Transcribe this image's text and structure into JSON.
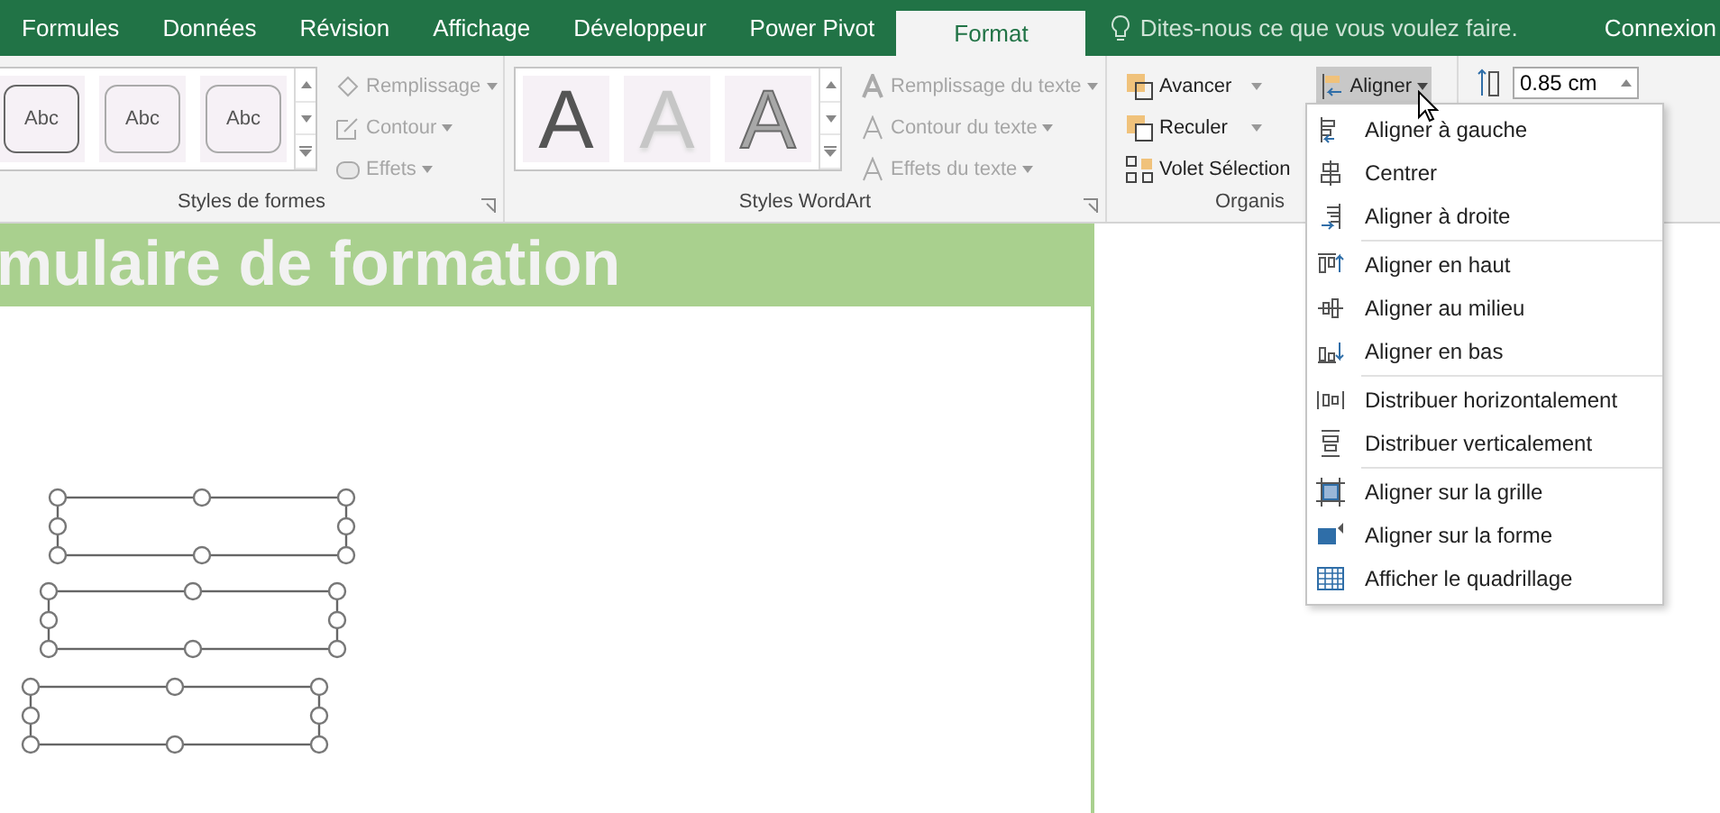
{
  "tabs": [
    {
      "label": "Formules",
      "selected": false
    },
    {
      "label": "Données",
      "selected": false
    },
    {
      "label": "Révision",
      "selected": false
    },
    {
      "label": "Affichage",
      "selected": false
    },
    {
      "label": "Développeur",
      "selected": false
    },
    {
      "label": "Power Pivot",
      "selected": false
    },
    {
      "label": "Format",
      "selected": true
    }
  ],
  "tell_me": {
    "placeholder": "Dites-nous ce que vous voulez faire."
  },
  "account": "Connexion",
  "shape_styles": {
    "label": "Styles de formes",
    "gallery": [
      "Abc",
      "Abc",
      "Abc"
    ],
    "buttons": [
      {
        "label": "Remplissage",
        "disabled": true
      },
      {
        "label": "Contour",
        "disabled": true
      },
      {
        "label": "Effets",
        "disabled": true
      }
    ]
  },
  "wordart_styles": {
    "label": "Styles WordArt",
    "gallery": [
      "A",
      "A",
      "A"
    ],
    "buttons": [
      {
        "label": "Remplissage du texte",
        "disabled": true
      },
      {
        "label": "Contour du texte",
        "disabled": true
      },
      {
        "label": "Effets du texte",
        "disabled": true
      }
    ]
  },
  "arrange": {
    "label": "Organis",
    "buttons": [
      {
        "label": "Avancer"
      },
      {
        "label": "Reculer"
      },
      {
        "label": "Volet Sélection"
      }
    ],
    "align_button": {
      "label": "Aligner",
      "pressed": true
    }
  },
  "size": {
    "height": "0.85 cm"
  },
  "sheet": {
    "title": "mulaire de formation"
  },
  "align_menu": [
    {
      "label": "Aligner à gauche",
      "separator_before": false
    },
    {
      "label": "Centrer",
      "separator_before": false
    },
    {
      "label": "Aligner à droite",
      "separator_before": false
    },
    {
      "label": "Aligner en haut",
      "separator_before": true
    },
    {
      "label": "Aligner au milieu",
      "separator_before": false
    },
    {
      "label": "Aligner en bas",
      "separator_before": false
    },
    {
      "label": "Distribuer horizontalement",
      "separator_before": true
    },
    {
      "label": "Distribuer verticalement",
      "separator_before": false
    },
    {
      "label": "Aligner sur la grille",
      "separator_before": true
    },
    {
      "label": "Aligner sur la forme",
      "separator_before": false
    },
    {
      "label": "Afficher le quadrillage",
      "separator_before": false
    }
  ]
}
